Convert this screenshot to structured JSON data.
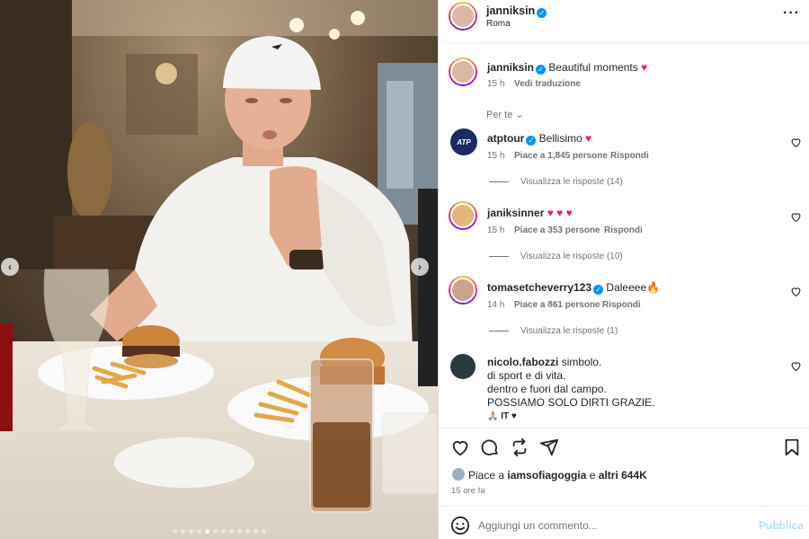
{
  "post": {
    "username": "janniksin",
    "location": "Roma",
    "caption": "Beautiful moments",
    "caption_time": "15 h",
    "translate": "Vedi traduzione",
    "filter": "Per te"
  },
  "comments": [
    {
      "user": "atptour",
      "verified": true,
      "text": "Bellisimo",
      "emoji": "♥",
      "time": "15 h",
      "likes": "Piace a 1,845 persone",
      "reply": "Rispondi",
      "replies": "Visualizza le risposte (14)"
    },
    {
      "user": "janiksinner",
      "verified": false,
      "text": "",
      "emoji": "♥ ♥ ♥",
      "time": "15 h",
      "likes": "Piace a 353 persone",
      "reply": "Rispondi",
      "replies": "Visualizza le risposte (10)"
    },
    {
      "user": "tomasetcheverry123",
      "verified": true,
      "text": "Daleeee",
      "emoji": "🔥",
      "time": "14 h",
      "likes": "Piace a 861 persone",
      "reply": "Rispondi",
      "replies": "Visualizza le risposte (1)"
    },
    {
      "user": "nicolo.fabozzi",
      "verified": false,
      "lines": [
        "simbolo.",
        "di sport e di vita.",
        "dentro e fuori dal campo.",
        "POSSIAMO SOLO DIRTI GRAZIE."
      ],
      "tail": "🙏🏼 IT ♥"
    }
  ],
  "footer": {
    "likes_prefix": "Piace a",
    "likes_user": "iamsofiagoggia",
    "likes_mid": "e",
    "likes_count": "altri 644K",
    "time": "15 ore fa",
    "comment_placeholder": "Aggiungi un commento...",
    "publish": "Pubblica"
  },
  "carousel": {
    "dots": 12,
    "active": 4
  }
}
